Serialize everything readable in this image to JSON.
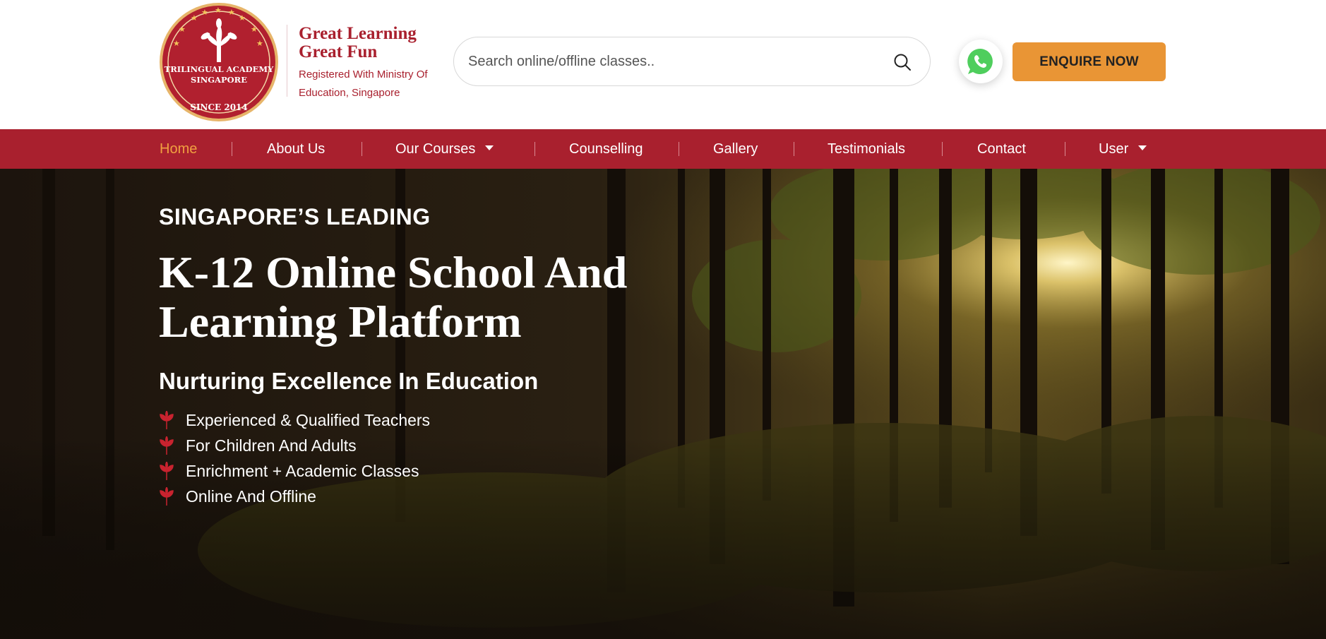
{
  "logo": {
    "name": "TRILINGUAL ACADEMY",
    "country": "SINGAPORE",
    "since": "SINCE 2014"
  },
  "tagline": {
    "line1": "Great Learning",
    "line2": "Great Fun",
    "sub": "Registered With Ministry Of Education, Singapore"
  },
  "search": {
    "placeholder": "Search online/offline classes.."
  },
  "header": {
    "enquire_label": "ENQUIRE NOW"
  },
  "nav": {
    "items": [
      {
        "label": "Home",
        "active": true
      },
      {
        "label": "About Us"
      },
      {
        "label": "Our Courses",
        "dropdown": true
      },
      {
        "label": "Counselling"
      },
      {
        "label": "Gallery"
      },
      {
        "label": "Testimonials"
      },
      {
        "label": "Contact"
      },
      {
        "label": "User",
        "dropdown": true
      }
    ]
  },
  "hero": {
    "kicker": "SINGAPORE’S LEADING",
    "headline": "K-12 Online School And Learning Platform",
    "subhead": "Nurturing Excellence In Education",
    "bullets": [
      "Experienced & Qualified Teachers",
      "For Children And Adults",
      "Enrichment + Academic Classes",
      "Online And Offline"
    ]
  },
  "colors": {
    "brand_red": "#a9202e",
    "accent_orange": "#e99535",
    "nav_active": "#f0a040",
    "whatsapp_green": "#4fce5d"
  },
  "icons": {
    "search": "search-icon",
    "whatsapp": "whatsapp-icon",
    "bullet": "leaf-icon",
    "dropdown": "caret-down-icon"
  }
}
